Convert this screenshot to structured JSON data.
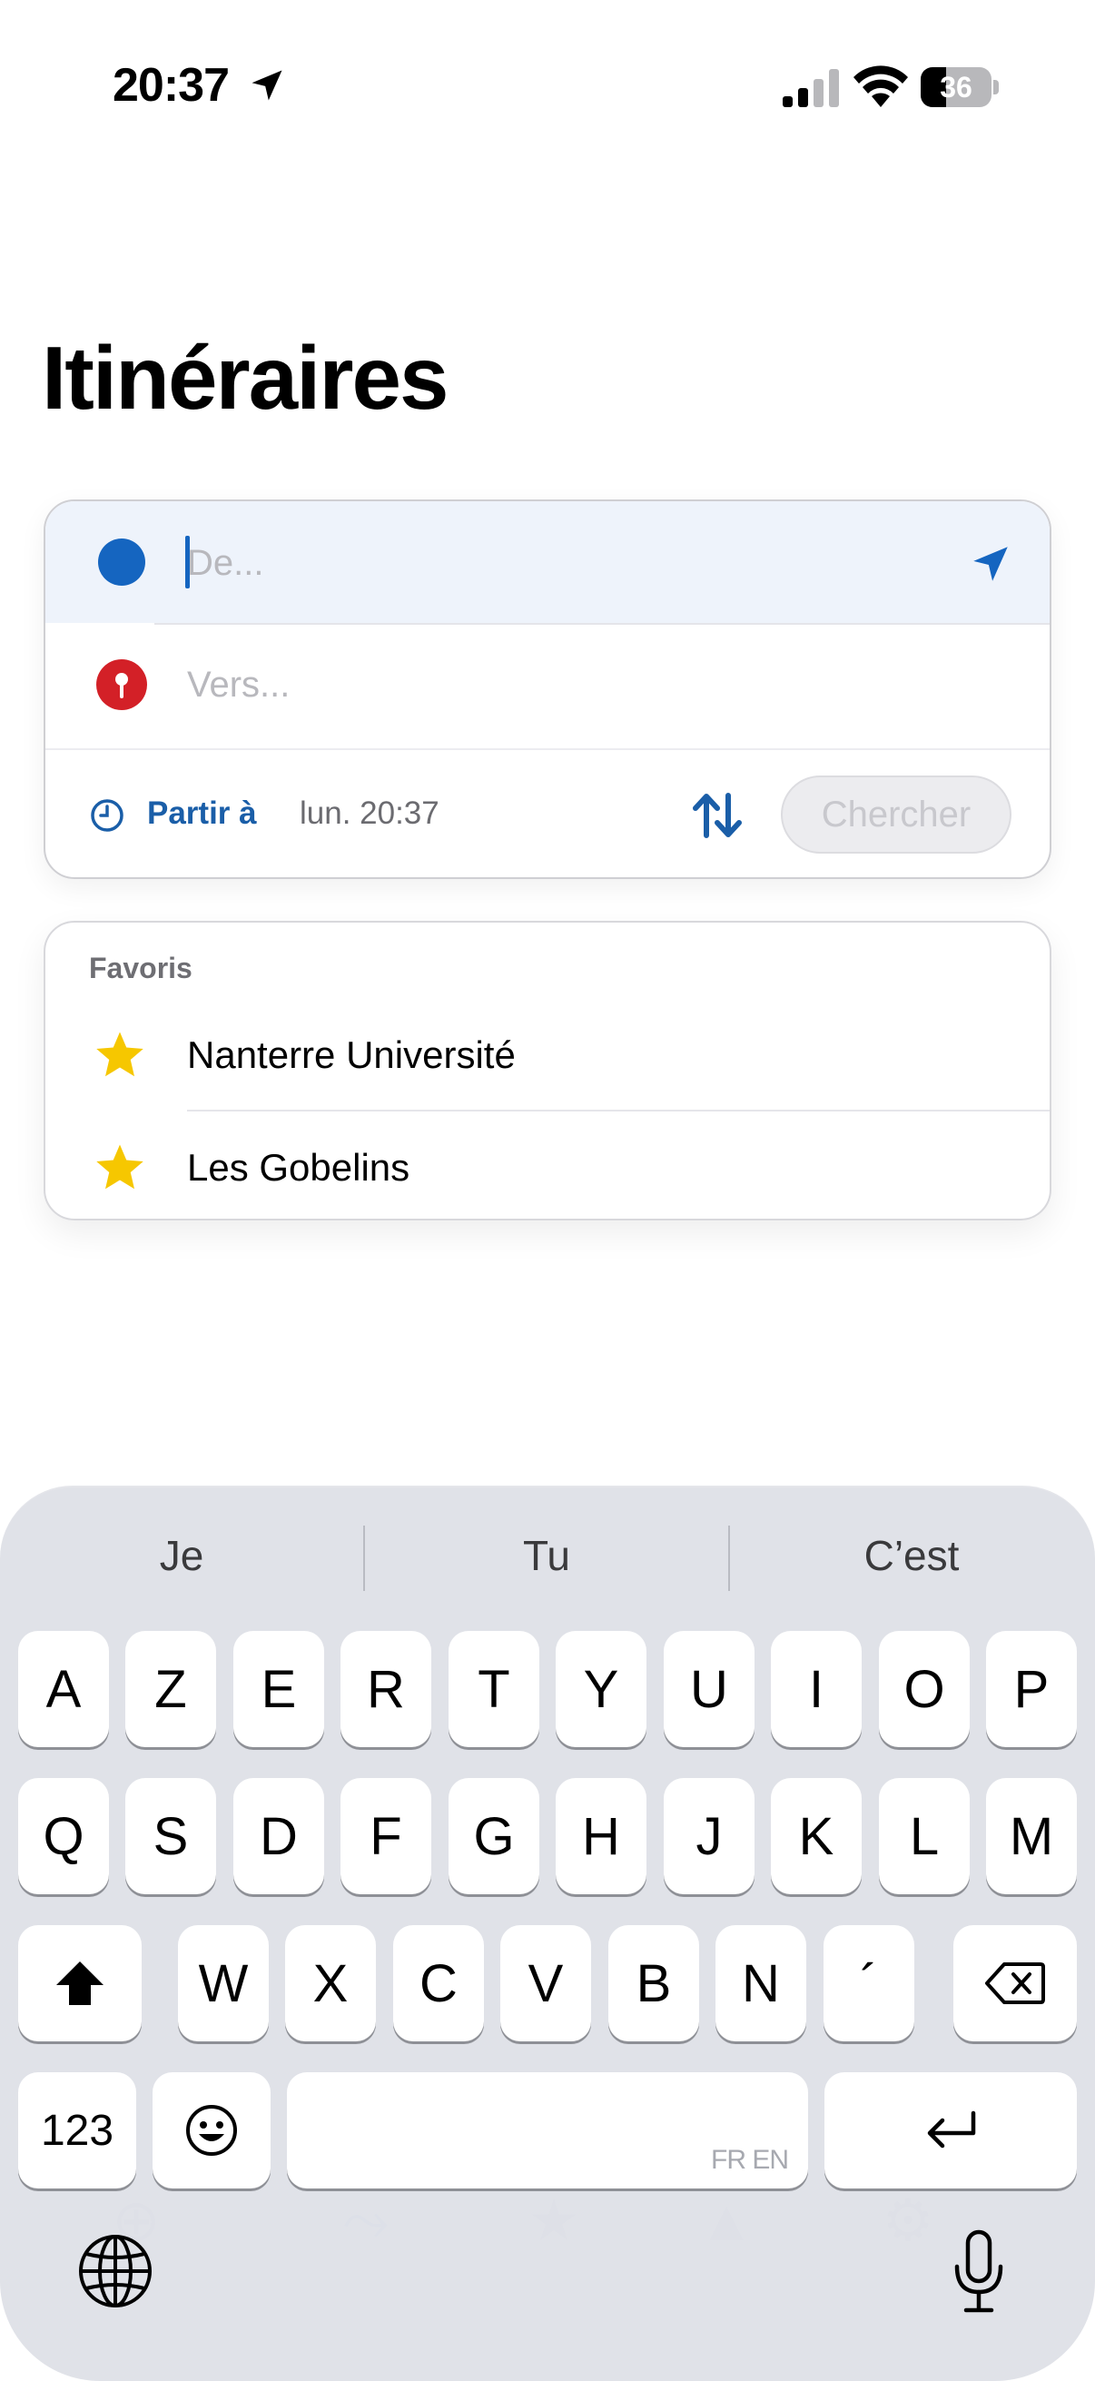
{
  "status_bar": {
    "time": "20:37",
    "battery": "36",
    "battery_level": 0.36,
    "location_icon": "location-arrow-icon",
    "signal_icon": "cellular-signal-icon",
    "wifi_icon": "wifi-icon"
  },
  "page": {
    "title": "Itinéraires"
  },
  "search": {
    "from_placeholder": "De...",
    "from_value": "",
    "to_placeholder": "Vers...",
    "to_value": "",
    "depart_label": "Partir à",
    "depart_time": "lun. 20:37",
    "search_button": "Chercher",
    "accent_color": "#1565c0",
    "pin_color": "#d32027"
  },
  "favorites": {
    "header": "Favoris",
    "items": [
      {
        "label": "Nanterre Université",
        "icon": "star-icon"
      },
      {
        "label": "Les Gobelins",
        "icon": "star-icon"
      }
    ],
    "star_color": "#f6c700"
  },
  "keyboard": {
    "suggestions": [
      "Je",
      "Tu",
      "C’est"
    ],
    "row1": [
      "A",
      "Z",
      "E",
      "R",
      "T",
      "Y",
      "U",
      "I",
      "O",
      "P"
    ],
    "row2": [
      "Q",
      "S",
      "D",
      "F",
      "G",
      "H",
      "J",
      "K",
      "L",
      "M"
    ],
    "row3": [
      "W",
      "X",
      "C",
      "V",
      "B",
      "N",
      "´"
    ],
    "numbers_key": "123",
    "space_languages": "FR EN"
  }
}
